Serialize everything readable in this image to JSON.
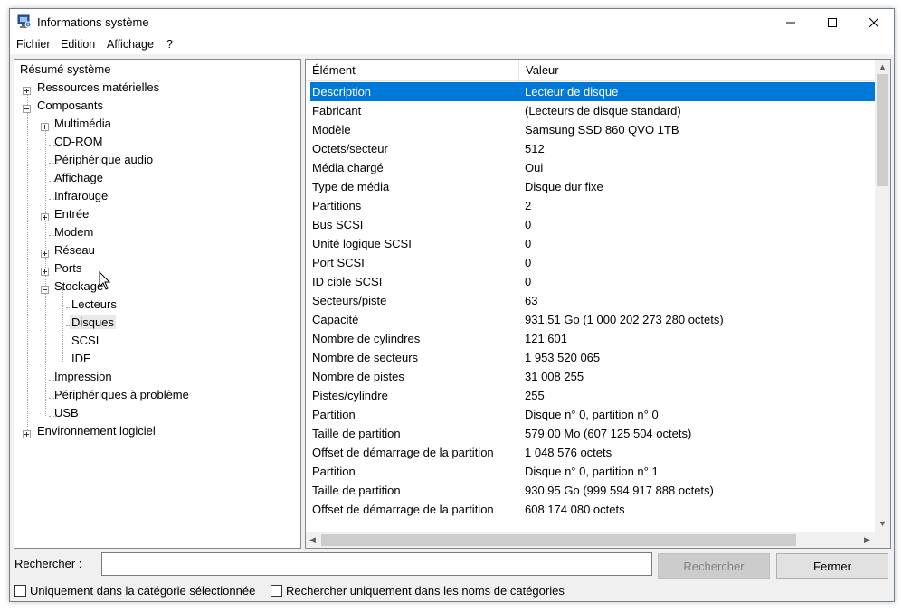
{
  "window": {
    "title": "Informations système"
  },
  "menu": [
    "Fichier",
    "Edition",
    "Affichage",
    "?"
  ],
  "tree": [
    {
      "label": "Résumé système"
    },
    {
      "label": "Ressources matérielles"
    },
    {
      "label": "Composants"
    },
    {
      "label": "Multimédia"
    },
    {
      "label": "CD-ROM"
    },
    {
      "label": "Périphérique audio"
    },
    {
      "label": "Affichage"
    },
    {
      "label": "Infrarouge"
    },
    {
      "label": "Entrée"
    },
    {
      "label": "Modem"
    },
    {
      "label": "Réseau"
    },
    {
      "label": "Ports"
    },
    {
      "label": "Stockage"
    },
    {
      "label": "Lecteurs"
    },
    {
      "label": "Disques"
    },
    {
      "label": "SCSI"
    },
    {
      "label": "IDE"
    },
    {
      "label": "Impression"
    },
    {
      "label": "Périphériques à problème"
    },
    {
      "label": "USB"
    },
    {
      "label": "Environnement logiciel"
    }
  ],
  "table": {
    "headers": [
      "Élément",
      "Valeur"
    ],
    "rows": [
      [
        "Description",
        "Lecteur de disque"
      ],
      [
        "Fabricant",
        "(Lecteurs de disque standard)"
      ],
      [
        "Modèle",
        "Samsung SSD 860 QVO 1TB"
      ],
      [
        "Octets/secteur",
        "512"
      ],
      [
        "Média chargé",
        "Oui"
      ],
      [
        "Type de média",
        "Disque dur fixe"
      ],
      [
        "Partitions",
        "2"
      ],
      [
        "Bus SCSI",
        "0"
      ],
      [
        "Unité logique SCSI",
        "0"
      ],
      [
        "Port SCSI",
        "0"
      ],
      [
        "ID cible SCSI",
        "0"
      ],
      [
        "Secteurs/piste",
        "63"
      ],
      [
        "Capacité",
        "931,51 Go (1 000 202 273 280 octets)"
      ],
      [
        "Nombre de cylindres",
        "121 601"
      ],
      [
        "Nombre de secteurs",
        "1 953 520 065"
      ],
      [
        "Nombre de pistes",
        "31 008 255"
      ],
      [
        "Pistes/cylindre",
        "255"
      ],
      [
        "Partition",
        "Disque n° 0, partition n° 0"
      ],
      [
        "Taille de partition",
        "579,00 Mo (607 125 504 octets)"
      ],
      [
        "Offset de démarrage de la partition",
        "1 048 576 octets"
      ],
      [
        "Partition",
        "Disque n° 0, partition n° 1"
      ],
      [
        "Taille de partition",
        "930,95 Go (999 594 917 888 octets)"
      ],
      [
        "Offset de démarrage de la partition",
        "608 174 080 octets"
      ]
    ]
  },
  "search": {
    "label": "Rechercher :",
    "value": "",
    "find_button": "Rechercher",
    "close_button": "Fermer",
    "option_category": "Uniquement dans la catégorie sélectionnée",
    "option_names": "Rechercher uniquement dans les noms de catégories"
  }
}
